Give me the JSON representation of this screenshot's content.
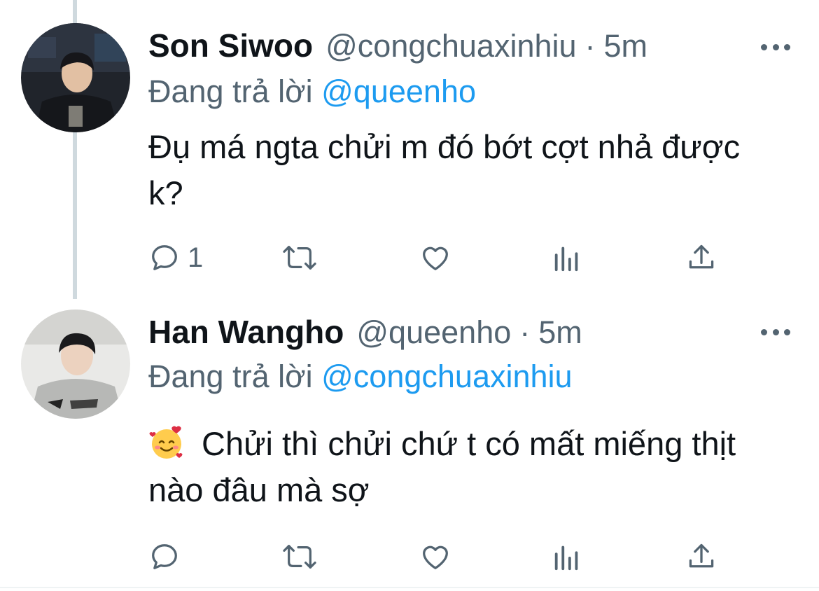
{
  "tweets": [
    {
      "display_name": "Son Siwoo",
      "handle": "@congchuaxinhiu",
      "separator": "·",
      "time": "5m",
      "replying_prefix": "Đang trả lời",
      "replying_to": "@queenho",
      "text": "Đụ má ngta chửi m đó bớt cợt nhả được k?",
      "reply_count": "1",
      "avatar_icon": "profile-photo-avatar"
    },
    {
      "display_name": "Han Wangho",
      "handle": "@queenho",
      "separator": "·",
      "time": "5m",
      "replying_prefix": "Đang trả lời",
      "replying_to": "@congchuaxinhiu",
      "emoji": "🥰",
      "text": "Chửi thì chửi chứ t có mất miếng thịt nào đâu mà sợ",
      "reply_count": "",
      "avatar_icon": "profile-photo-avatar"
    }
  ],
  "icons": {
    "reply": "reply-icon",
    "retweet": "retweet-icon",
    "like": "like-heart-icon",
    "views": "views-bar-chart-icon",
    "share": "share-upload-icon",
    "more": "more-dots-icon"
  },
  "colors": {
    "text": "#0f1419",
    "secondary": "#536471",
    "link": "#1d9bf0",
    "thread_line": "#cfd9de"
  }
}
